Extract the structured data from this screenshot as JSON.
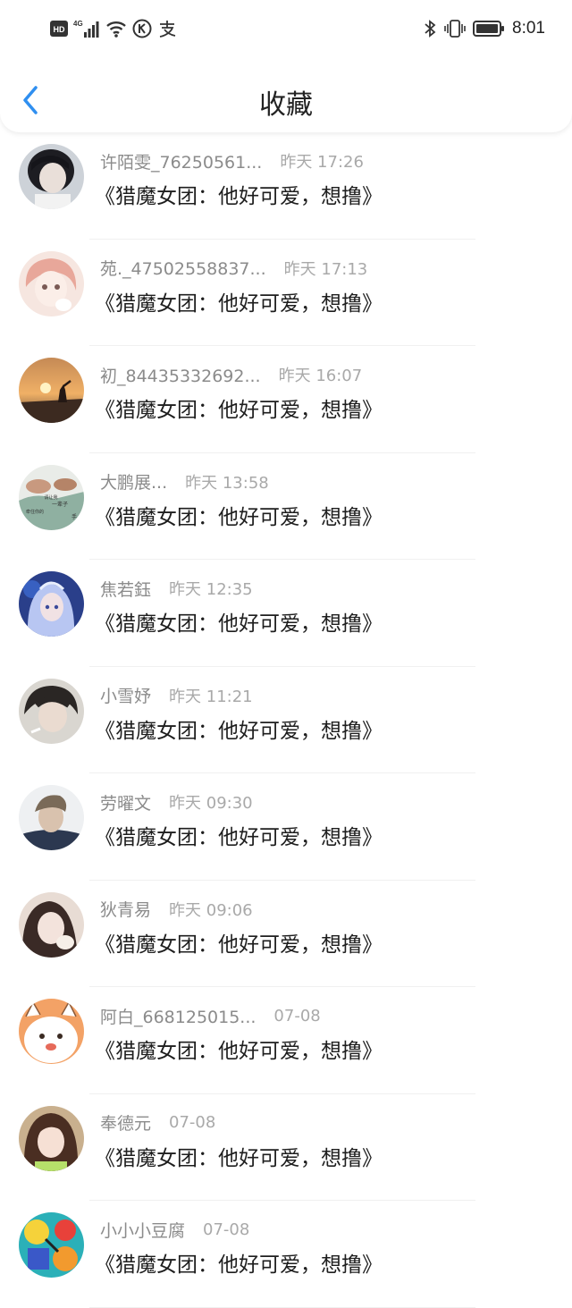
{
  "status_bar": {
    "left_labels": [
      "HD",
      "4G"
    ],
    "time": "8:01",
    "icons": [
      "hd-icon",
      "signal-icon",
      "wifi-icon",
      "k-app-icon",
      "alipay-icon",
      "bluetooth-icon",
      "vibrate-icon",
      "battery-icon"
    ]
  },
  "navbar": {
    "title": "收藏",
    "back_icon": "chevron-left-icon",
    "accent": "#2f8ff0"
  },
  "items": [
    {
      "name": "许陌雯_76250561...",
      "time": "昨天 17:26",
      "content": "《猎魔女团：他好可爱，想撸》",
      "avatar": "dark-haired-boy"
    },
    {
      "name": "苑._47502558837...",
      "time": "昨天 17:13",
      "content": "《猎魔女团：他好可爱，想撸》",
      "avatar": "anime-girl"
    },
    {
      "name": "初_84435332692...",
      "time": "昨天 16:07",
      "content": "《猎魔女团：他好可爱，想撸》",
      "avatar": "sunset-silhouette"
    },
    {
      "name": "大鹏展...",
      "time": "昨天 13:58",
      "content": "《猎魔女团：他好可爱，想撸》",
      "avatar": "hands-text",
      "avatar_text": [
        "请让我",
        "一辈子",
        "牵住你的",
        "手"
      ]
    },
    {
      "name": "焦若鈺",
      "time": "昨天 12:35",
      "content": "《猎魔女团：他好可爱，想撸》",
      "avatar": "fantasy-character"
    },
    {
      "name": "小雪妤",
      "time": "昨天 11:21",
      "content": "《猎魔女团：他好可爱，想撸》",
      "avatar": "smoking-boy"
    },
    {
      "name": "劳曜文",
      "time": "昨天 09:30",
      "content": "《猎魔女团：他好可爱，想撸》",
      "avatar": "blond-boy"
    },
    {
      "name": "狄青易",
      "time": "昨天 09:06",
      "content": "《猎魔女团：他好可爱，想撸》",
      "avatar": "girl-selfie"
    },
    {
      "name": "阿白_668125015...",
      "time": "07-08",
      "content": "《猎魔女团：他好可爱，想撸》",
      "avatar": "cartoon-cat"
    },
    {
      "name": "奉德元",
      "time": "07-08",
      "content": "《猎魔女团：他好可爱，想撸》",
      "avatar": "girl-portrait"
    },
    {
      "name": "小小小豆腐",
      "time": "07-08",
      "content": "《猎魔女团：他好可爱，想撸》",
      "avatar": "colorful-cartoon"
    }
  ]
}
